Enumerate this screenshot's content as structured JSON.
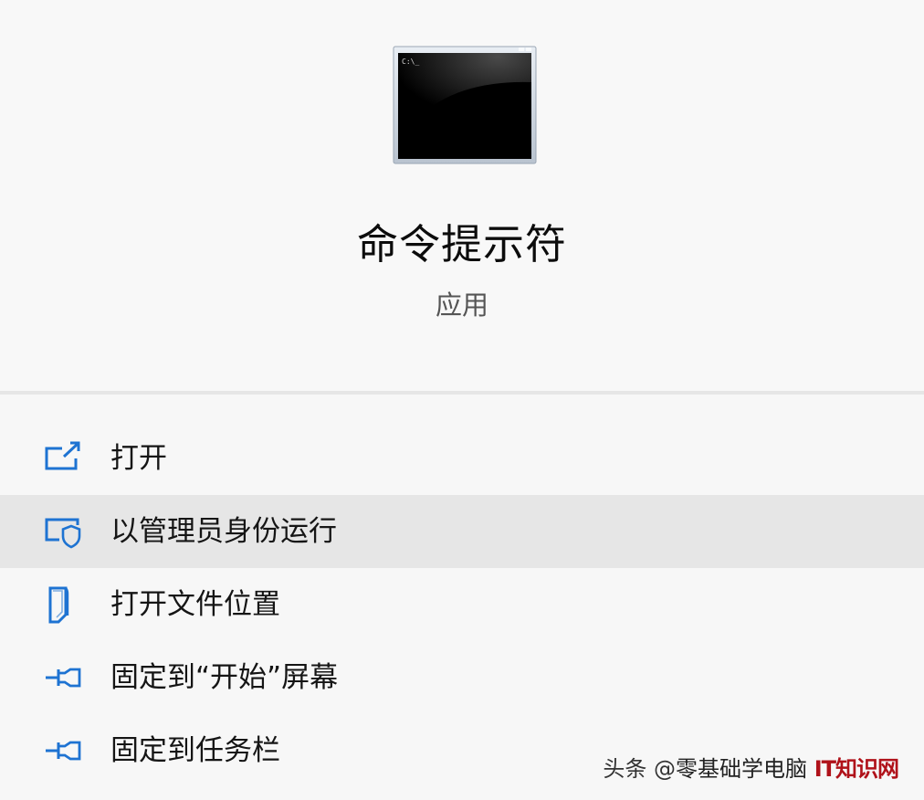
{
  "app": {
    "icon": "command-prompt-icon",
    "icon_prompt_text": "C:\\_",
    "title": "命令提示符",
    "type": "应用"
  },
  "menu": {
    "items": [
      {
        "label": "打开",
        "icon": "open-external-icon",
        "highlighted": false
      },
      {
        "label": "以管理员身份运行",
        "icon": "admin-shield-icon",
        "highlighted": true
      },
      {
        "label": "打开文件位置",
        "icon": "folder-location-icon",
        "highlighted": false
      },
      {
        "label": "固定到“开始”屏幕",
        "icon": "pin-icon",
        "highlighted": false
      },
      {
        "label": "固定到任务栏",
        "icon": "pin-icon",
        "highlighted": false
      }
    ]
  },
  "watermark": {
    "prefix": "头条 @",
    "handle": "零基础学电脑",
    "brand": "IT知识网"
  },
  "colors": {
    "accent_blue": "#1e73d2",
    "highlight_bg": "#e6e6e6",
    "panel_bg": "#f7f7f7",
    "watermark_red": "#b0121a"
  }
}
